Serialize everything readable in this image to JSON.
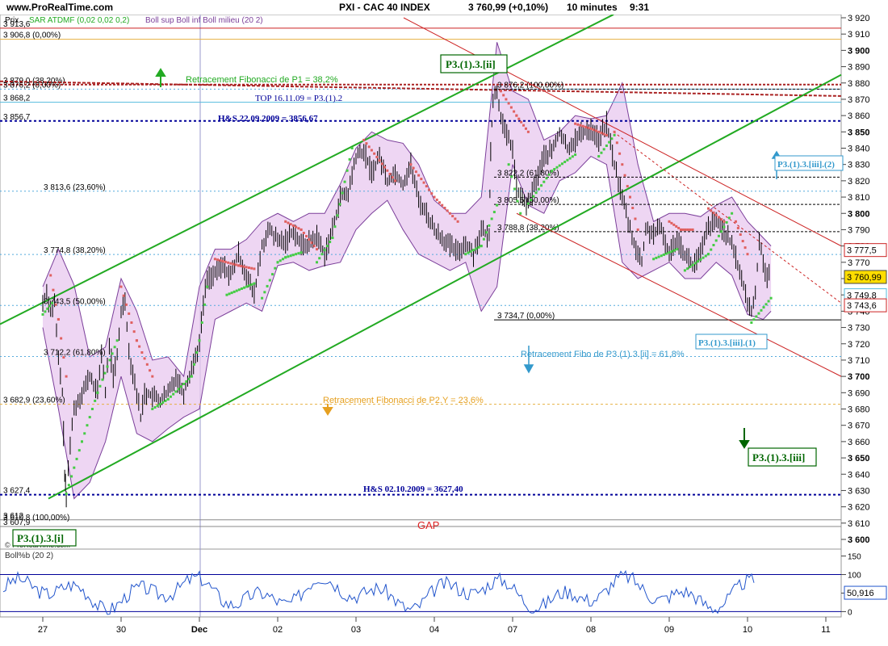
{
  "header": {
    "site": "www.ProRealTime.com",
    "instrument": "PXI - CAC 40 INDEX",
    "last": "3 760,99 (+0,10%)",
    "interval": "10 minutes",
    "time": "9:31"
  },
  "legend": {
    "prix": "Prix",
    "sar": "SAR ATDMF (0,02 0,02 0,2)",
    "boll": "Boll sup Boll inf Boll milieu (20 2)",
    "osc": "Boll%b (20 2)",
    "copyright": "© ProRealTime.com"
  },
  "colors": {
    "price": "#000000",
    "sar_up": "#44cc44",
    "sar_down": "#e06060",
    "boll_fill": "#e8c8ef",
    "boll_line": "#7b3f9a",
    "channel_green": "#22aa22",
    "channel_red": "#cc2222",
    "hs_blue": "#000099",
    "fib_cyan": "#3399cc",
    "fib_orange": "#e6a020",
    "annot_green": "#006600"
  },
  "chart_data": {
    "type": "candlestick",
    "y_ticks": [
      "3 920",
      "3 910",
      "3 900",
      "3 890",
      "3 880",
      "3 870",
      "3 860",
      "3 850",
      "3 840",
      "3 830",
      "3 820",
      "3 810",
      "3 800",
      "3 790",
      "3 780",
      "3 770",
      "3 760",
      "3 750",
      "3 740",
      "3 730",
      "3 720",
      "3 710",
      "3 700",
      "3 690",
      "3 680",
      "3 670",
      "3 660",
      "3 650",
      "3 640",
      "3 630",
      "3 620",
      "3 610",
      "3 600"
    ],
    "y_tick_values": [
      3920,
      3910,
      3900,
      3890,
      3880,
      3870,
      3860,
      3850,
      3840,
      3830,
      3820,
      3810,
      3800,
      3790,
      3780,
      3770,
      3760,
      3750,
      3740,
      3730,
      3720,
      3710,
      3700,
      3690,
      3680,
      3670,
      3660,
      3650,
      3640,
      3630,
      3620,
      3610,
      3600
    ],
    "ylim": [
      3600,
      3920
    ],
    "x_ticks": [
      "27",
      "30",
      "Dec",
      "02",
      "03",
      "04",
      "07",
      "08",
      "09",
      "10",
      "11"
    ],
    "x_tick_index": [
      0,
      1,
      2,
      3,
      4,
      5,
      6,
      7,
      8,
      9,
      10
    ],
    "price_path": [
      [
        0,
        3745
      ],
      [
        0.05,
        3752
      ],
      [
        0.1,
        3741
      ],
      [
        0.15,
        3745
      ],
      [
        0.2,
        3710
      ],
      [
        0.25,
        3690
      ],
      [
        0.28,
        3640
      ],
      [
        0.3,
        3625
      ],
      [
        0.35,
        3660
      ],
      [
        0.4,
        3680
      ],
      [
        0.5,
        3690
      ],
      [
        0.6,
        3700
      ],
      [
        0.7,
        3690
      ],
      [
        0.75,
        3715
      ],
      [
        0.8,
        3690
      ],
      [
        0.85,
        3720
      ],
      [
        0.9,
        3700
      ],
      [
        0.95,
        3712
      ],
      [
        1.0,
        3740
      ],
      [
        1.05,
        3748
      ],
      [
        1.1,
        3715
      ],
      [
        1.2,
        3690
      ],
      [
        1.25,
        3675
      ],
      [
        1.3,
        3690
      ],
      [
        1.4,
        3688
      ],
      [
        1.5,
        3685
      ],
      [
        1.6,
        3690
      ],
      [
        1.7,
        3700
      ],
      [
        1.8,
        3690
      ],
      [
        1.9,
        3705
      ],
      [
        2.0,
        3720
      ],
      [
        2.05,
        3745
      ],
      [
        2.1,
        3760
      ],
      [
        2.2,
        3763
      ],
      [
        2.3,
        3768
      ],
      [
        2.4,
        3762
      ],
      [
        2.5,
        3775
      ],
      [
        2.6,
        3762
      ],
      [
        2.7,
        3750
      ],
      [
        2.8,
        3780
      ],
      [
        2.9,
        3790
      ],
      [
        3.0,
        3783
      ],
      [
        3.1,
        3783
      ],
      [
        3.2,
        3790
      ],
      [
        3.3,
        3780
      ],
      [
        3.4,
        3782
      ],
      [
        3.5,
        3786
      ],
      [
        3.6,
        3775
      ],
      [
        3.7,
        3790
      ],
      [
        3.8,
        3810
      ],
      [
        3.9,
        3812
      ],
      [
        4.0,
        3835
      ],
      [
        4.1,
        3838
      ],
      [
        4.2,
        3825
      ],
      [
        4.3,
        3835
      ],
      [
        4.4,
        3820
      ],
      [
        4.5,
        3825
      ],
      [
        4.6,
        3818
      ],
      [
        4.7,
        3830
      ],
      [
        4.8,
        3808
      ],
      [
        4.9,
        3800
      ],
      [
        5.0,
        3790
      ],
      [
        5.1,
        3785
      ],
      [
        5.2,
        3780
      ],
      [
        5.3,
        3776
      ],
      [
        5.4,
        3782
      ],
      [
        5.5,
        3775
      ],
      [
        5.6,
        3790
      ],
      [
        5.7,
        3785
      ],
      [
        5.72,
        3840
      ],
      [
        5.75,
        3870
      ],
      [
        5.8,
        3875
      ],
      [
        5.85,
        3860
      ],
      [
        5.9,
        3850
      ],
      [
        6.0,
        3840
      ],
      [
        6.05,
        3815
      ],
      [
        6.1,
        3810
      ],
      [
        6.2,
        3805
      ],
      [
        6.3,
        3820
      ],
      [
        6.4,
        3835
      ],
      [
        6.5,
        3838
      ],
      [
        6.6,
        3850
      ],
      [
        6.7,
        3840
      ],
      [
        6.8,
        3845
      ],
      [
        6.9,
        3850
      ],
      [
        7.0,
        3852
      ],
      [
        7.1,
        3845
      ],
      [
        7.2,
        3855
      ],
      [
        7.3,
        3830
      ],
      [
        7.4,
        3810
      ],
      [
        7.45,
        3800
      ],
      [
        7.5,
        3790
      ],
      [
        7.6,
        3775
      ],
      [
        7.65,
        3770
      ],
      [
        7.7,
        3790
      ],
      [
        7.8,
        3788
      ],
      [
        7.9,
        3790
      ],
      [
        8.0,
        3775
      ],
      [
        8.1,
        3785
      ],
      [
        8.2,
        3775
      ],
      [
        8.3,
        3768
      ],
      [
        8.4,
        3775
      ],
      [
        8.5,
        3792
      ],
      [
        8.6,
        3795
      ],
      [
        8.7,
        3790
      ],
      [
        8.8,
        3780
      ],
      [
        8.9,
        3765
      ],
      [
        9.0,
        3745
      ],
      [
        9.05,
        3740
      ],
      [
        9.1,
        3750
      ],
      [
        9.15,
        3785
      ],
      [
        9.2,
        3770
      ],
      [
        9.25,
        3762
      ],
      [
        9.3,
        3761
      ]
    ],
    "sar_up_runs": [
      [
        [
          0,
          3738
        ],
        [
          0.12,
          3745
        ]
      ],
      [
        [
          0.3,
          3628
        ],
        [
          0.5,
          3660
        ],
        [
          0.7,
          3690
        ],
        [
          0.95,
          3722
        ]
      ],
      [
        [
          1.4,
          3680
        ],
        [
          1.6,
          3686
        ],
        [
          1.9,
          3700
        ],
        [
          2.0,
          3722
        ],
        [
          2.1,
          3755
        ]
      ],
      [
        [
          2.35,
          3750
        ],
        [
          2.7,
          3757
        ]
      ],
      [
        [
          2.8,
          3748
        ],
        [
          3.0,
          3770
        ],
        [
          3.1,
          3773
        ],
        [
          3.3,
          3776
        ]
      ],
      [
        [
          3.5,
          3770
        ],
        [
          3.7,
          3785
        ],
        [
          3.95,
          3840
        ]
      ],
      [
        [
          5.4,
          3775
        ],
        [
          5.6,
          3780
        ],
        [
          5.8,
          3805
        ]
      ],
      [
        [
          5.95,
          3830
        ],
        [
          6.1,
          3800
        ]
      ],
      [
        [
          6.2,
          3806
        ],
        [
          6.5,
          3826
        ],
        [
          6.8,
          3836
        ]
      ],
      [
        [
          7.1,
          3835
        ],
        [
          7.3,
          3848
        ]
      ],
      [
        [
          7.8,
          3772
        ],
        [
          8.1,
          3778
        ]
      ],
      [
        [
          8.2,
          3765
        ],
        [
          8.5,
          3775
        ],
        [
          8.8,
          3800
        ]
      ],
      [
        [
          9.05,
          3733
        ],
        [
          9.3,
          3748
        ]
      ]
    ],
    "sar_down_runs": [
      [
        [
          0.1,
          3762
        ],
        [
          0.2,
          3735
        ],
        [
          0.3,
          3700
        ]
      ],
      [
        [
          1.0,
          3755
        ],
        [
          1.2,
          3722
        ],
        [
          1.4,
          3700
        ]
      ],
      [
        [
          2.2,
          3772
        ],
        [
          2.5,
          3768
        ],
        [
          2.7,
          3766
        ]
      ],
      [
        [
          3.1,
          3795
        ],
        [
          3.3,
          3790
        ],
        [
          3.5,
          3778
        ]
      ],
      [
        [
          4.1,
          3845
        ],
        [
          4.5,
          3820
        ]
      ],
      [
        [
          4.7,
          3830
        ],
        [
          5.0,
          3810
        ],
        [
          5.3,
          3795
        ]
      ],
      [
        [
          5.85,
          3875
        ],
        [
          6.05,
          3860
        ],
        [
          6.2,
          3850
        ]
      ],
      [
        [
          6.8,
          3855
        ],
        [
          7.0,
          3852
        ],
        [
          7.2,
          3848
        ]
      ],
      [
        [
          7.3,
          3850
        ],
        [
          7.5,
          3810
        ],
        [
          7.6,
          3790
        ]
      ],
      [
        [
          8.0,
          3795
        ],
        [
          8.15,
          3790
        ],
        [
          8.3,
          3790
        ]
      ],
      [
        [
          8.5,
          3803
        ],
        [
          8.7,
          3795
        ]
      ],
      [
        [
          8.85,
          3795
        ],
        [
          9.0,
          3775
        ]
      ]
    ],
    "boll_upper": [
      [
        0,
        3755
      ],
      [
        0.2,
        3778
      ],
      [
        0.4,
        3756
      ],
      [
        0.6,
        3712
      ],
      [
        0.8,
        3718
      ],
      [
        1.0,
        3760
      ],
      [
        1.2,
        3740
      ],
      [
        1.4,
        3710
      ],
      [
        1.6,
        3712
      ],
      [
        1.8,
        3700
      ],
      [
        2.0,
        3755
      ],
      [
        2.2,
        3778
      ],
      [
        2.4,
        3778
      ],
      [
        2.6,
        3784
      ],
      [
        2.8,
        3795
      ],
      [
        3.0,
        3800
      ],
      [
        3.2,
        3795
      ],
      [
        3.4,
        3800
      ],
      [
        3.6,
        3800
      ],
      [
        3.8,
        3818
      ],
      [
        4.0,
        3840
      ],
      [
        4.2,
        3850
      ],
      [
        4.4,
        3845
      ],
      [
        4.6,
        3843
      ],
      [
        4.8,
        3830
      ],
      [
        5.0,
        3808
      ],
      [
        5.2,
        3800
      ],
      [
        5.4,
        3800
      ],
      [
        5.6,
        3810
      ],
      [
        5.8,
        3905
      ],
      [
        6.0,
        3875
      ],
      [
        6.2,
        3870
      ],
      [
        6.4,
        3845
      ],
      [
        6.6,
        3850
      ],
      [
        6.8,
        3860
      ],
      [
        7.0,
        3858
      ],
      [
        7.2,
        3860
      ],
      [
        7.4,
        3880
      ],
      [
        7.6,
        3830
      ],
      [
        7.8,
        3795
      ],
      [
        8.0,
        3800
      ],
      [
        8.2,
        3800
      ],
      [
        8.4,
        3798
      ],
      [
        8.6,
        3805
      ],
      [
        8.8,
        3810
      ],
      [
        9.0,
        3795
      ],
      [
        9.2,
        3785
      ],
      [
        9.3,
        3780
      ]
    ],
    "boll_lower": [
      [
        0,
        3730
      ],
      [
        0.2,
        3680
      ],
      [
        0.4,
        3625
      ],
      [
        0.6,
        3635
      ],
      [
        0.8,
        3660
      ],
      [
        1.0,
        3700
      ],
      [
        1.2,
        3665
      ],
      [
        1.4,
        3660
      ],
      [
        1.6,
        3668
      ],
      [
        1.8,
        3675
      ],
      [
        2.0,
        3680
      ],
      [
        2.2,
        3735
      ],
      [
        2.4,
        3740
      ],
      [
        2.6,
        3745
      ],
      [
        2.8,
        3740
      ],
      [
        3.0,
        3768
      ],
      [
        3.2,
        3770
      ],
      [
        3.4,
        3765
      ],
      [
        3.6,
        3768
      ],
      [
        3.8,
        3770
      ],
      [
        4.0,
        3790
      ],
      [
        4.2,
        3800
      ],
      [
        4.4,
        3808
      ],
      [
        4.6,
        3790
      ],
      [
        4.8,
        3775
      ],
      [
        5.0,
        3770
      ],
      [
        5.2,
        3765
      ],
      [
        5.4,
        3770
      ],
      [
        5.6,
        3740
      ],
      [
        5.8,
        3755
      ],
      [
        6.0,
        3830
      ],
      [
        6.2,
        3805
      ],
      [
        6.4,
        3800
      ],
      [
        6.6,
        3820
      ],
      [
        6.8,
        3825
      ],
      [
        7.0,
        3835
      ],
      [
        7.2,
        3830
      ],
      [
        7.4,
        3770
      ],
      [
        7.6,
        3760
      ],
      [
        7.8,
        3765
      ],
      [
        8.0,
        3770
      ],
      [
        8.2,
        3760
      ],
      [
        8.4,
        3760
      ],
      [
        8.6,
        3770
      ],
      [
        8.8,
        3762
      ],
      [
        9.0,
        3738
      ],
      [
        9.2,
        3735
      ],
      [
        9.3,
        3740
      ]
    ],
    "levels": [
      {
        "label": "3 913,6",
        "value": 3913.6,
        "style": "red"
      },
      {
        "label": "3 906,8 (0,00%)",
        "value": 3906.8,
        "style": "orange"
      },
      {
        "label": "3 879,0 (38,20%)",
        "value": 3879,
        "style": "darkred"
      },
      {
        "label": "3 876,2 (0,00%)",
        "value": 3876.2,
        "style": "cyanfib"
      },
      {
        "label": "3 868,2",
        "value": 3868.2,
        "style": "cyan"
      },
      {
        "label": "3 856,7",
        "value": 3856.7,
        "style": "hs"
      },
      {
        "label": "3 813,6 (23,60%)",
        "value": 3813.6,
        "style": "cyanfib"
      },
      {
        "label": "3 774,8 (38,20%)",
        "value": 3774.8,
        "style": "cyanfib"
      },
      {
        "label": "3 743,5 (50,00%)",
        "value": 3743.5,
        "style": "cyanfib"
      },
      {
        "label": "3 712,2 (61,80%)",
        "value": 3712.2,
        "style": "cyanfib"
      },
      {
        "label": "3 682,9 (23,60%)",
        "value": 3682.9,
        "style": "orangefib"
      },
      {
        "label": "3 627,4",
        "value": 3627.4,
        "style": "hs"
      },
      {
        "label": "3 612",
        "value": 3612,
        "style": "gray"
      },
      {
        "label": "3 610,8 (100,00%)",
        "value": 3610.8,
        "style": "none"
      },
      {
        "label": "3 607,9",
        "value": 3607.9,
        "style": "gray"
      }
    ],
    "fib_right_labels": [
      {
        "label": "3 876,2 (100,00%)",
        "value": 3876.2
      },
      {
        "label": "3 822,2 (61,80%)",
        "value": 3822.2
      },
      {
        "label": "3 805,5 (50,00%)",
        "value": 3805.5
      },
      {
        "label": "3 788,8 (38,20%)",
        "value": 3788.8
      },
      {
        "label": "3 734,7 (0,00%)",
        "value": 3734.7
      }
    ],
    "annotations": {
      "fib_p1": "Retracement Fibonacci de P1 = 38,2%",
      "top": "TOP 16.11.09 = P3.(1).2",
      "hs1": "H&S 22.09.2009 = 3856,67",
      "hs2": "H&S 02.10.2009 = 3627,40",
      "gap": "GAP",
      "fib_p2": "Retracement Fibonacci de P2.Y = 23,6%",
      "fibo_p3": "Retracement Fibo de P3.(1).3.[ii] = 61,8%",
      "box_ii": "P3.(1).3.[ii]",
      "box_i": "P3.(1).3.[i]",
      "box_iii": "P3.(1).3.[iii]",
      "box_iii_2": "P3.(1).3.[iii].(2)",
      "box_iii_1": "P3.(1).3.[iii].(1)"
    },
    "right_badges": [
      {
        "label": "3 777,5",
        "value": 3777.5,
        "style": "red"
      },
      {
        "label": "3 760,99",
        "value": 3761,
        "style": "yellow"
      },
      {
        "label": "3 749,8",
        "value": 3749.8,
        "style": "cyan"
      },
      {
        "label": "3 743,6",
        "value": 3743.6,
        "style": "red"
      }
    ],
    "osc_ticks": [
      "150",
      "100",
      "50",
      "0"
    ],
    "osc_tick_values": [
      150,
      100,
      50,
      0
    ],
    "osc_last": "50,916",
    "osc_last_value": 50.916
  }
}
